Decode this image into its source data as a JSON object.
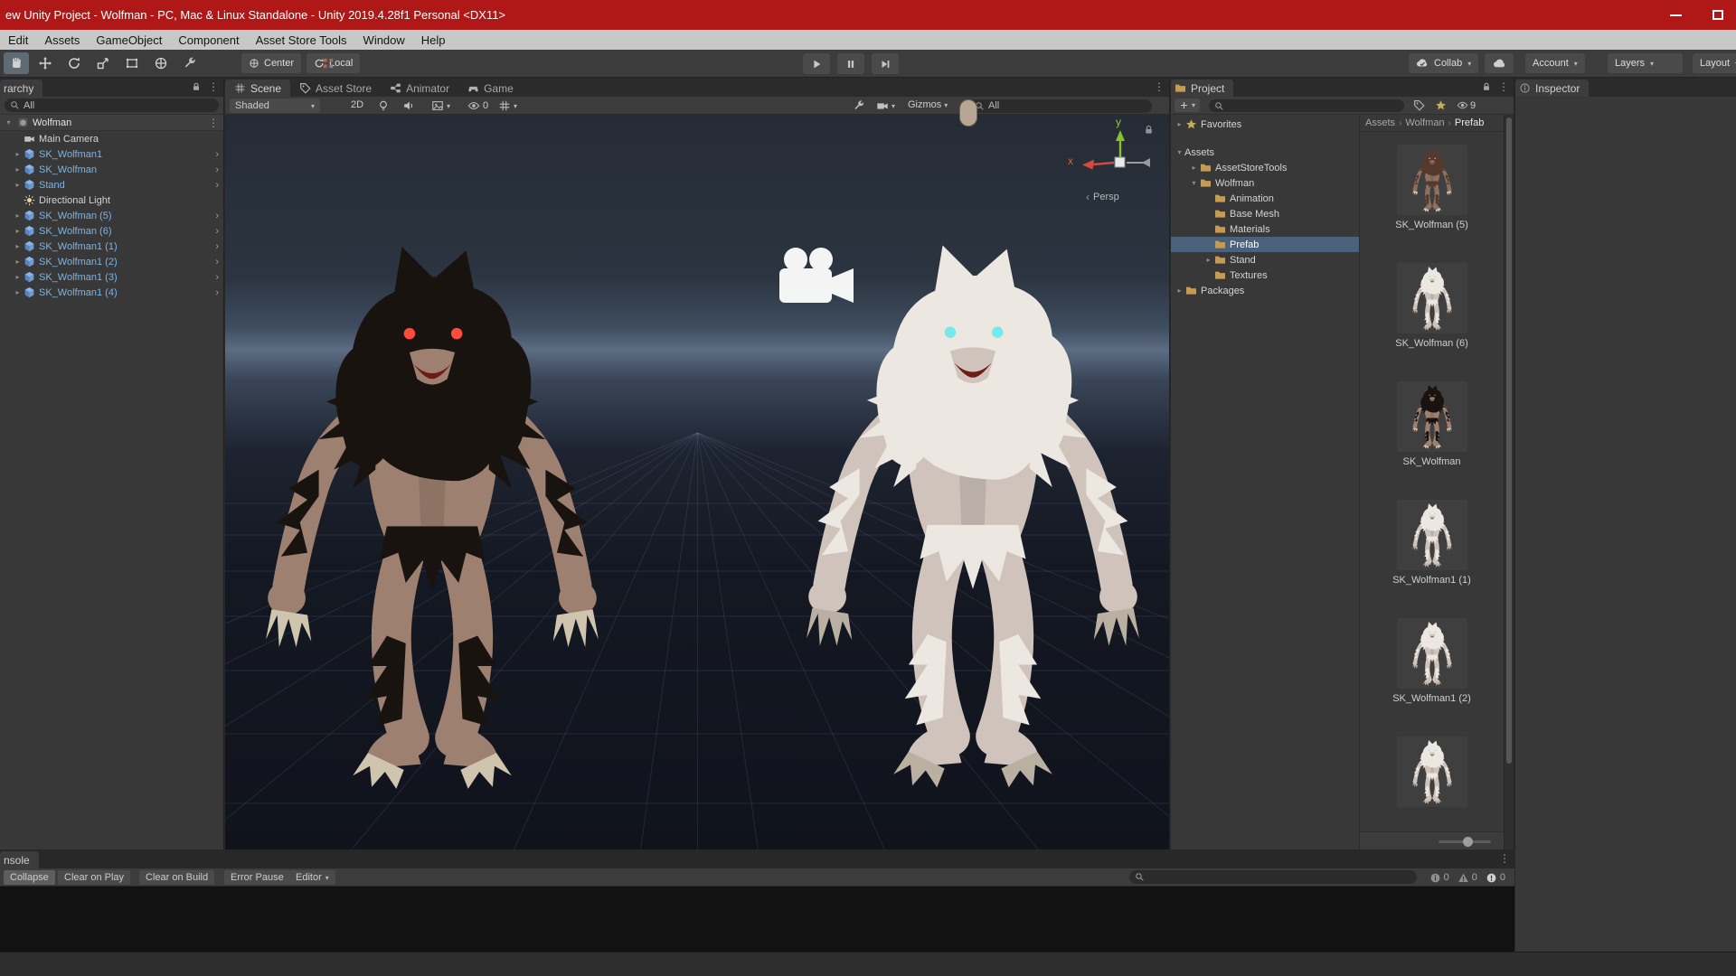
{
  "window": {
    "title": "ew Unity Project - Wolfman - PC, Mac & Linux Standalone - Unity 2019.4.28f1 Personal <DX11>"
  },
  "menu": {
    "items": [
      "Edit",
      "Assets",
      "GameObject",
      "Component",
      "Asset Store Tools",
      "Window",
      "Help"
    ]
  },
  "toolbar": {
    "pivot": "Center",
    "space": "Local",
    "collab": "Collab",
    "account": "Account",
    "layers": "Layers",
    "layout": "Layout"
  },
  "hierarchy": {
    "tab": "rarchy",
    "search_value": "All",
    "scene_name": "Wolfman",
    "items": [
      {
        "label": "Main Camera",
        "kind": "camera",
        "prefab": false,
        "expandable": false
      },
      {
        "label": "SK_Wolfman1",
        "kind": "prefab",
        "prefab": true,
        "expandable": true
      },
      {
        "label": "SK_Wolfman",
        "kind": "prefab",
        "prefab": true,
        "expandable": true
      },
      {
        "label": "Stand",
        "kind": "prefab",
        "prefab": true,
        "expandable": true
      },
      {
        "label": "Directional Light",
        "kind": "light",
        "prefab": false,
        "expandable": false
      },
      {
        "label": "SK_Wolfman (5)",
        "kind": "prefab",
        "prefab": true,
        "expandable": true
      },
      {
        "label": "SK_Wolfman (6)",
        "kind": "prefab",
        "prefab": true,
        "expandable": true
      },
      {
        "label": "SK_Wolfman1 (1)",
        "kind": "prefab",
        "prefab": true,
        "expandable": true
      },
      {
        "label": "SK_Wolfman1 (2)",
        "kind": "prefab",
        "prefab": true,
        "expandable": true
      },
      {
        "label": "SK_Wolfman1 (3)",
        "kind": "prefab",
        "prefab": true,
        "expandable": true
      },
      {
        "label": "SK_Wolfman1 (4)",
        "kind": "prefab",
        "prefab": true,
        "expandable": true
      }
    ]
  },
  "scene_view": {
    "tabs": [
      "Scene",
      "Asset Store",
      "Animator",
      "Game"
    ],
    "toolbar": {
      "shading": "Shaded",
      "toggle_2d": "2D",
      "visibility_count": "0",
      "gizmos": "Gizmos",
      "search_value": "All"
    },
    "axis": {
      "x": "x",
      "y": "y",
      "projection": "Persp"
    }
  },
  "project": {
    "tab": "Project",
    "hidden_count": "9",
    "breadcrumb": [
      "Assets",
      "Wolfman",
      "Prefab"
    ],
    "tree": [
      {
        "label": "Favorites"
      },
      {
        "label": "Assets"
      },
      {
        "label": "AssetStoreTools"
      },
      {
        "label": "Wolfman"
      },
      {
        "label": "Animation"
      },
      {
        "label": "Base Mesh"
      },
      {
        "label": "Materials"
      },
      {
        "label": "Prefab"
      },
      {
        "label": "Stand"
      },
      {
        "label": "Textures"
      },
      {
        "label": "Packages"
      }
    ],
    "assets": [
      {
        "label": "SK_Wolfman (5)",
        "variant": "brown"
      },
      {
        "label": "SK_Wolfman (6)",
        "variant": "white"
      },
      {
        "label": "SK_Wolfman",
        "variant": "black"
      },
      {
        "label": "SK_Wolfman1 (1)",
        "variant": "white"
      },
      {
        "label": "SK_Wolfman1 (2)",
        "variant": "white"
      },
      {
        "label": "",
        "variant": "white"
      }
    ]
  },
  "inspector": {
    "tab": "Inspector"
  },
  "console": {
    "tab": "nsole",
    "buttons": [
      "Collapse",
      "Clear on Play",
      "Clear on Build",
      "Error Pause",
      "Editor"
    ],
    "counts": {
      "info": "0",
      "warnings": "0",
      "errors": "0"
    }
  },
  "colors": {
    "titlebar": "#b01717",
    "selection": "#4a617c",
    "prefab_text": "#7fb3e1"
  }
}
